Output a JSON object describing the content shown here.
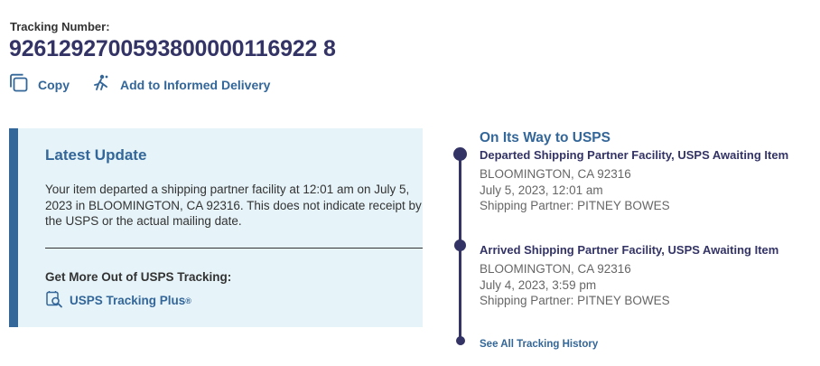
{
  "tracking": {
    "label": "Tracking Number:",
    "number": "9261292700593800000116922 8"
  },
  "actions": {
    "copy_label": "Copy",
    "informed_label": "Add to Informed Delivery"
  },
  "latest_update": {
    "title": "Latest Update",
    "text": "Your item departed a shipping partner facility at 12:01 am on July 5, 2023 in BLOOMINGTON, CA 92316. This does not indicate receipt by the USPS or the actual mailing date.",
    "more_title": "Get More Out of USPS Tracking:",
    "plus_label": "USPS Tracking Plus",
    "plus_mark": "®"
  },
  "timeline": {
    "status": "On Its Way to USPS",
    "events": [
      {
        "title": "Departed Shipping Partner Facility, USPS Awaiting Item",
        "location": "BLOOMINGTON, CA 92316",
        "datetime": "July 5, 2023, 12:01 am",
        "partner": "Shipping Partner: PITNEY BOWES"
      },
      {
        "title": "Arrived Shipping Partner Facility, USPS Awaiting Item",
        "location": "BLOOMINGTON, CA 92316",
        "datetime": "July 4, 2023, 3:59 pm",
        "partner": "Shipping Partner: PITNEY BOWES"
      }
    ],
    "history_link": "See All Tracking History"
  },
  "icons": {
    "copy": "copy-icon",
    "informed": "informed-delivery-icon",
    "plus": "tracking-plus-icon"
  },
  "colors": {
    "navy": "#333366",
    "link_blue": "#336699",
    "panel_bg": "#e6f3f8"
  }
}
